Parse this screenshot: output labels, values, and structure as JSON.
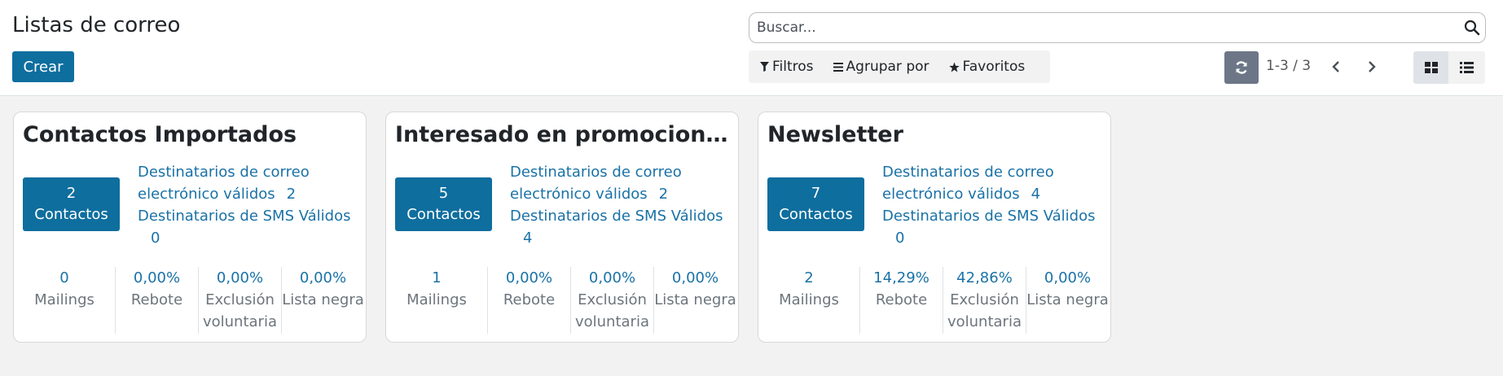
{
  "header": {
    "title": "Listas de correo",
    "create_label": "Crear"
  },
  "search": {
    "placeholder": "Buscar..."
  },
  "filters": {
    "filters_label": "Filtros",
    "group_by_label": "Agrupar por",
    "favorites_label": "Favoritos"
  },
  "pager": {
    "value": "1-3 / 3"
  },
  "colors": {
    "primary": "#0e6e9e",
    "link": "#1a72a6",
    "muted": "#6c757d"
  },
  "cards": [
    {
      "title": "Contactos Importados",
      "contacts_count": "2",
      "contacts_label": "Contactos",
      "email_label": "Destinatarios de correo electrónico válidos",
      "email_count": "2",
      "sms_label": "Destinatarios de SMS Válidos",
      "sms_count": "0",
      "stats": [
        {
          "value": "0",
          "label": "Mailings"
        },
        {
          "value": "0,00%",
          "label": "Rebote"
        },
        {
          "value": "0,00%",
          "label": "Exclusión voluntaria"
        },
        {
          "value": "0,00%",
          "label": "Lista negra"
        }
      ]
    },
    {
      "title": "Interesado en promociones ...",
      "contacts_count": "5",
      "contacts_label": "Contactos",
      "email_label": "Destinatarios de correo electrónico válidos",
      "email_count": "2",
      "sms_label": "Destinatarios de SMS Válidos",
      "sms_count": "4",
      "stats": [
        {
          "value": "1",
          "label": "Mailings"
        },
        {
          "value": "0,00%",
          "label": "Rebote"
        },
        {
          "value": "0,00%",
          "label": "Exclusión voluntaria"
        },
        {
          "value": "0,00%",
          "label": "Lista negra"
        }
      ]
    },
    {
      "title": "Newsletter",
      "contacts_count": "7",
      "contacts_label": "Contactos",
      "email_label": "Destinatarios de correo electrónico válidos",
      "email_count": "4",
      "sms_label": "Destinatarios de SMS Válidos",
      "sms_count": "0",
      "stats": [
        {
          "value": "2",
          "label": "Mailings"
        },
        {
          "value": "14,29%",
          "label": "Rebote"
        },
        {
          "value": "42,86%",
          "label": "Exclusión voluntaria"
        },
        {
          "value": "0,00%",
          "label": "Lista negra"
        }
      ]
    }
  ],
  "icons": {
    "search": "search-icon",
    "filter": "filter-icon",
    "group": "list-icon",
    "favorite": "star-icon",
    "refresh": "refresh-icon",
    "prev": "chevron-left-icon",
    "next": "chevron-right-icon",
    "kanban": "kanban-view-icon",
    "list": "list-view-icon"
  }
}
